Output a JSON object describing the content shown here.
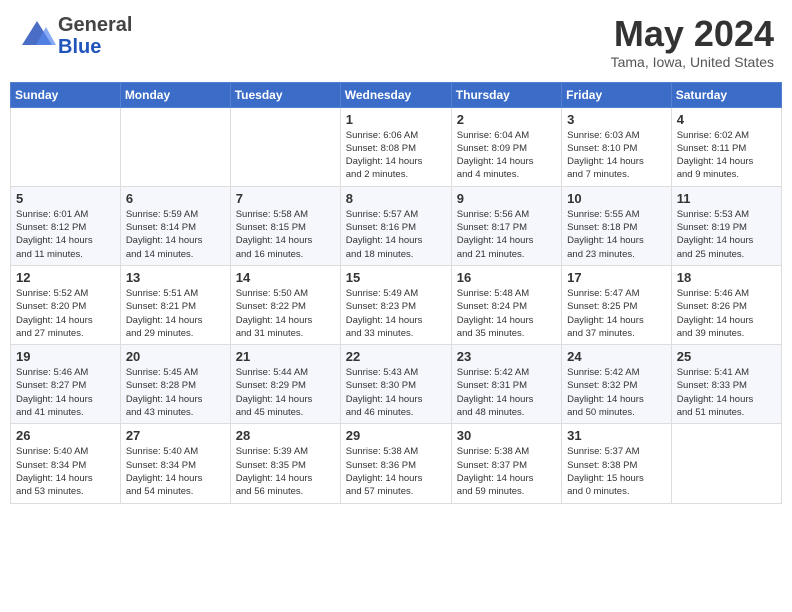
{
  "header": {
    "logo_general": "General",
    "logo_blue": "Blue",
    "month_title": "May 2024",
    "location": "Tama, Iowa, United States"
  },
  "days_of_week": [
    "Sunday",
    "Monday",
    "Tuesday",
    "Wednesday",
    "Thursday",
    "Friday",
    "Saturday"
  ],
  "weeks": [
    [
      {
        "day": "",
        "info": ""
      },
      {
        "day": "",
        "info": ""
      },
      {
        "day": "",
        "info": ""
      },
      {
        "day": "1",
        "info": "Sunrise: 6:06 AM\nSunset: 8:08 PM\nDaylight: 14 hours\nand 2 minutes."
      },
      {
        "day": "2",
        "info": "Sunrise: 6:04 AM\nSunset: 8:09 PM\nDaylight: 14 hours\nand 4 minutes."
      },
      {
        "day": "3",
        "info": "Sunrise: 6:03 AM\nSunset: 8:10 PM\nDaylight: 14 hours\nand 7 minutes."
      },
      {
        "day": "4",
        "info": "Sunrise: 6:02 AM\nSunset: 8:11 PM\nDaylight: 14 hours\nand 9 minutes."
      }
    ],
    [
      {
        "day": "5",
        "info": "Sunrise: 6:01 AM\nSunset: 8:12 PM\nDaylight: 14 hours\nand 11 minutes."
      },
      {
        "day": "6",
        "info": "Sunrise: 5:59 AM\nSunset: 8:14 PM\nDaylight: 14 hours\nand 14 minutes."
      },
      {
        "day": "7",
        "info": "Sunrise: 5:58 AM\nSunset: 8:15 PM\nDaylight: 14 hours\nand 16 minutes."
      },
      {
        "day": "8",
        "info": "Sunrise: 5:57 AM\nSunset: 8:16 PM\nDaylight: 14 hours\nand 18 minutes."
      },
      {
        "day": "9",
        "info": "Sunrise: 5:56 AM\nSunset: 8:17 PM\nDaylight: 14 hours\nand 21 minutes."
      },
      {
        "day": "10",
        "info": "Sunrise: 5:55 AM\nSunset: 8:18 PM\nDaylight: 14 hours\nand 23 minutes."
      },
      {
        "day": "11",
        "info": "Sunrise: 5:53 AM\nSunset: 8:19 PM\nDaylight: 14 hours\nand 25 minutes."
      }
    ],
    [
      {
        "day": "12",
        "info": "Sunrise: 5:52 AM\nSunset: 8:20 PM\nDaylight: 14 hours\nand 27 minutes."
      },
      {
        "day": "13",
        "info": "Sunrise: 5:51 AM\nSunset: 8:21 PM\nDaylight: 14 hours\nand 29 minutes."
      },
      {
        "day": "14",
        "info": "Sunrise: 5:50 AM\nSunset: 8:22 PM\nDaylight: 14 hours\nand 31 minutes."
      },
      {
        "day": "15",
        "info": "Sunrise: 5:49 AM\nSunset: 8:23 PM\nDaylight: 14 hours\nand 33 minutes."
      },
      {
        "day": "16",
        "info": "Sunrise: 5:48 AM\nSunset: 8:24 PM\nDaylight: 14 hours\nand 35 minutes."
      },
      {
        "day": "17",
        "info": "Sunrise: 5:47 AM\nSunset: 8:25 PM\nDaylight: 14 hours\nand 37 minutes."
      },
      {
        "day": "18",
        "info": "Sunrise: 5:46 AM\nSunset: 8:26 PM\nDaylight: 14 hours\nand 39 minutes."
      }
    ],
    [
      {
        "day": "19",
        "info": "Sunrise: 5:46 AM\nSunset: 8:27 PM\nDaylight: 14 hours\nand 41 minutes."
      },
      {
        "day": "20",
        "info": "Sunrise: 5:45 AM\nSunset: 8:28 PM\nDaylight: 14 hours\nand 43 minutes."
      },
      {
        "day": "21",
        "info": "Sunrise: 5:44 AM\nSunset: 8:29 PM\nDaylight: 14 hours\nand 45 minutes."
      },
      {
        "day": "22",
        "info": "Sunrise: 5:43 AM\nSunset: 8:30 PM\nDaylight: 14 hours\nand 46 minutes."
      },
      {
        "day": "23",
        "info": "Sunrise: 5:42 AM\nSunset: 8:31 PM\nDaylight: 14 hours\nand 48 minutes."
      },
      {
        "day": "24",
        "info": "Sunrise: 5:42 AM\nSunset: 8:32 PM\nDaylight: 14 hours\nand 50 minutes."
      },
      {
        "day": "25",
        "info": "Sunrise: 5:41 AM\nSunset: 8:33 PM\nDaylight: 14 hours\nand 51 minutes."
      }
    ],
    [
      {
        "day": "26",
        "info": "Sunrise: 5:40 AM\nSunset: 8:34 PM\nDaylight: 14 hours\nand 53 minutes."
      },
      {
        "day": "27",
        "info": "Sunrise: 5:40 AM\nSunset: 8:34 PM\nDaylight: 14 hours\nand 54 minutes."
      },
      {
        "day": "28",
        "info": "Sunrise: 5:39 AM\nSunset: 8:35 PM\nDaylight: 14 hours\nand 56 minutes."
      },
      {
        "day": "29",
        "info": "Sunrise: 5:38 AM\nSunset: 8:36 PM\nDaylight: 14 hours\nand 57 minutes."
      },
      {
        "day": "30",
        "info": "Sunrise: 5:38 AM\nSunset: 8:37 PM\nDaylight: 14 hours\nand 59 minutes."
      },
      {
        "day": "31",
        "info": "Sunrise: 5:37 AM\nSunset: 8:38 PM\nDaylight: 15 hours\nand 0 minutes."
      },
      {
        "day": "",
        "info": ""
      }
    ]
  ]
}
